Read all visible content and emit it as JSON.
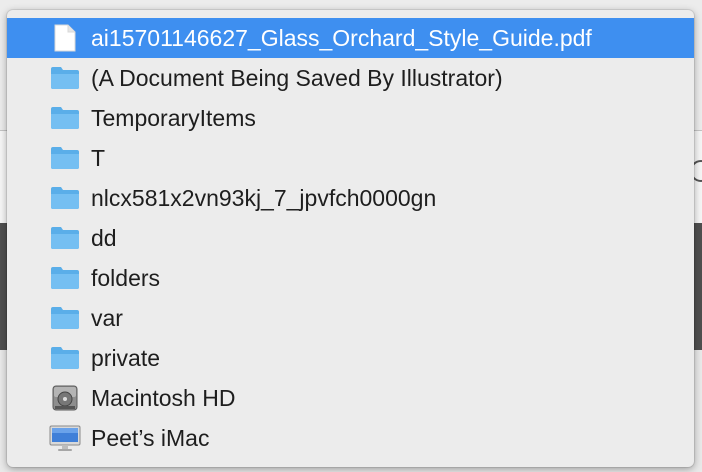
{
  "menu": {
    "items": [
      {
        "label": "ai15701146627_Glass_Orchard_Style_Guide.pdf",
        "icon": "document-icon",
        "selected": true
      },
      {
        "label": "(A Document Being Saved By Illustrator)",
        "icon": "folder-icon"
      },
      {
        "label": "TemporaryItems",
        "icon": "folder-icon"
      },
      {
        "label": "T",
        "icon": "folder-icon"
      },
      {
        "label": "nlcx581x2vn93kj_7_jpvfch0000gn",
        "icon": "folder-icon"
      },
      {
        "label": "dd",
        "icon": "folder-icon"
      },
      {
        "label": "folders",
        "icon": "folder-icon"
      },
      {
        "label": "var",
        "icon": "folder-icon"
      },
      {
        "label": "private",
        "icon": "folder-icon"
      },
      {
        "label": "Macintosh HD",
        "icon": "hard-drive-icon"
      },
      {
        "label": "Peet’s iMac",
        "icon": "imac-icon"
      }
    ]
  },
  "colors": {
    "selection": "#3e8ff0",
    "folder": "#67b6ee",
    "menu_bg": "#ececec"
  }
}
